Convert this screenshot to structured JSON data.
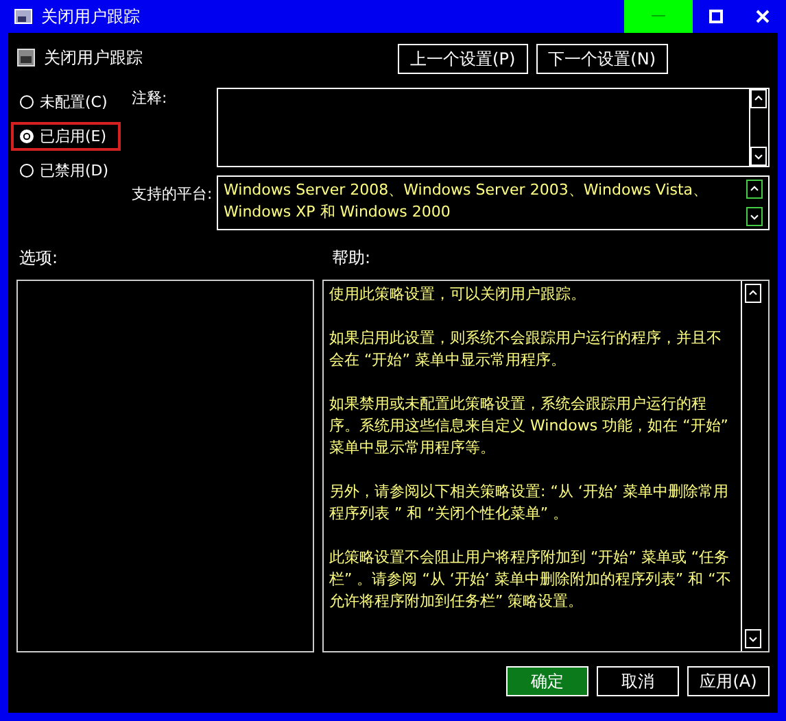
{
  "window": {
    "title": "关闭用户跟踪",
    "controls": [
      {
        "kind": "minimize",
        "hovered": true
      },
      {
        "kind": "maximize",
        "hovered": false
      },
      {
        "kind": "close",
        "hovered": false
      }
    ]
  },
  "header": {
    "title": "关闭用户跟踪",
    "buttons": [
      "上一个设置(P)",
      "下一个设置(N)"
    ]
  },
  "state_options": [
    {
      "label": "未配置(C)",
      "selected": false,
      "highlighted": false
    },
    {
      "label": "已启用(E)",
      "selected": true,
      "highlighted": true
    },
    {
      "label": "已禁用(D)",
      "selected": false,
      "highlighted": false
    }
  ],
  "comment": {
    "label": "注释:"
  },
  "platform": {
    "label": "支持的平台:",
    "value": "Windows Server 2008、Windows Server 2003、Windows Vista、Windows XP 和 Windows 2000"
  },
  "options": {
    "label": "选项:"
  },
  "help": {
    "label": "帮助:",
    "paragraphs": [
      "使用此策略设置，可以关闭用户跟踪。",
      "如果启用此设置，则系统不会跟踪用户运行的程序，并且不会在 “开始” 菜单中显示常用程序。",
      "如果禁用或未配置此策略设置，系统会跟踪用户运行的程序。系统用这些信息来自定义 Windows 功能，如在 “开始” 菜单中显示常用程序等。",
      "另外，请参阅以下相关策略设置: “从 ‘开始’ 菜单中删除常用程序列表 ” 和 “关闭个性化菜单” 。",
      "此策略设置不会阻止用户将程序附加到 “开始” 菜单或 “任务栏” 。请参阅 “从 ‘开始’ 菜单中删除附加的程序列表” 和 “不允许将程序附加到任务栏” 策略设置。"
    ]
  },
  "buttons": [
    {
      "label": "确定",
      "default": true
    },
    {
      "label": "取消",
      "default": false
    },
    {
      "label": "应用(A)",
      "default": false
    }
  ]
}
